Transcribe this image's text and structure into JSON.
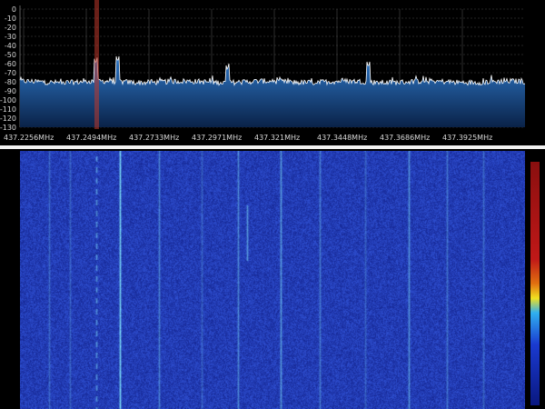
{
  "spectrum": {
    "db_ticks": [
      "0",
      "-10",
      "-20",
      "-30",
      "-40",
      "-50",
      "-60",
      "-70",
      "-80",
      "-90",
      "-100",
      "-110",
      "-120",
      "-130"
    ],
    "freq_ticks": [
      "437.2256MHz",
      "437.2494MHz",
      "437.2733MHz",
      "437.2971MHz",
      "437.321MHz",
      "437.3448MHz",
      "437.3686MHz",
      "437.3925MHz"
    ],
    "ylim": [
      -130,
      0
    ],
    "noise_floor_db": -80,
    "fill_color": "#1f5fa8",
    "trace_color": "#ffffff",
    "marker_color": "#c0392b",
    "grid_color": "#4a4a4a",
    "peaks": [
      {
        "freq_index": 1.5,
        "db": -58
      },
      {
        "freq_index": 1.15,
        "db": -60
      },
      {
        "freq_index": 3.25,
        "db": -67
      },
      {
        "freq_index": 5.5,
        "db": -64
      }
    ]
  },
  "waterfall": {
    "background_color": "#1a2fb8",
    "colorbar_colors": [
      "#8a0f0f",
      "#c01818",
      "#e07010",
      "#f0e020",
      "#30b0f0",
      "#1a3ad0",
      "#0a1880"
    ]
  }
}
